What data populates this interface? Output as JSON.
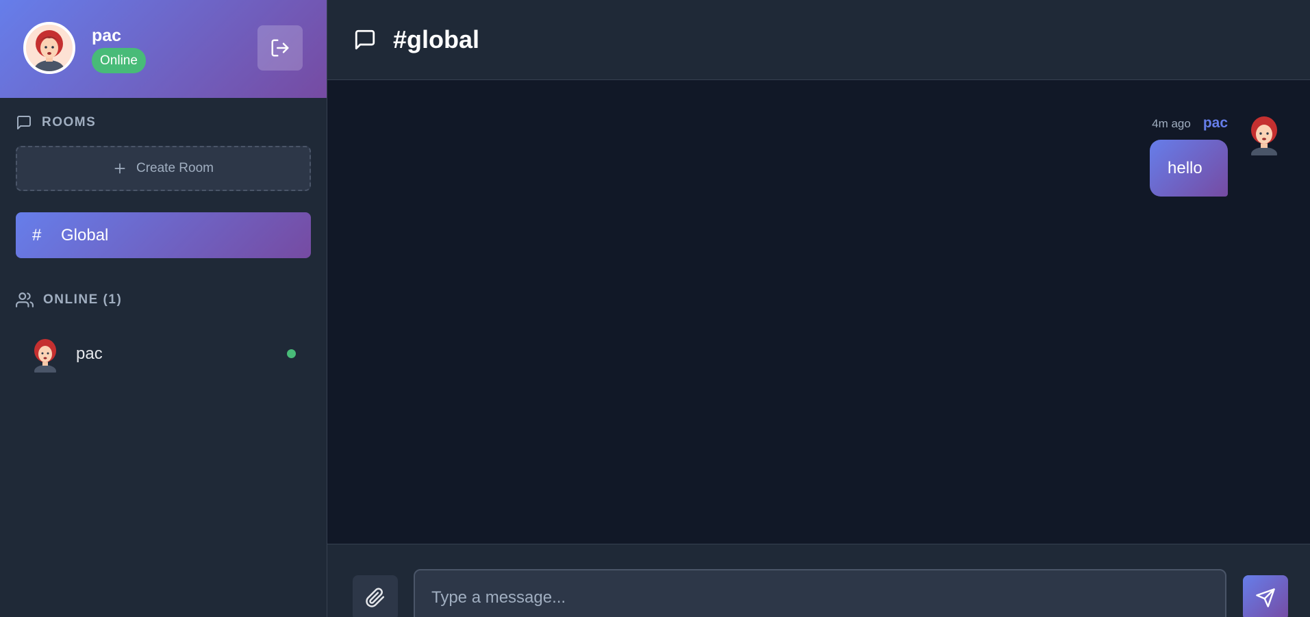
{
  "user": {
    "name": "pac",
    "status": "Online"
  },
  "sidebar": {
    "rooms_heading": "ROOMS",
    "create_room_label": "Create Room",
    "rooms": [
      {
        "hash": "#",
        "label": "Global",
        "active": true
      }
    ],
    "online_heading": "ONLINE (1)",
    "online_users": [
      {
        "name": "pac"
      }
    ]
  },
  "chat": {
    "title": "#global",
    "messages": [
      {
        "time": "4m ago",
        "author": "pac",
        "text": "hello"
      }
    ]
  },
  "composer": {
    "placeholder": "Type a message..."
  },
  "colors": {
    "accent_gradient_start": "#667eea",
    "accent_gradient_end": "#764ba2",
    "online_green": "#48bb78",
    "sidebar_bg": "#1f2937",
    "main_bg": "#111827"
  },
  "icons": {
    "logout": "logout-icon",
    "rooms": "chat-bubble-icon",
    "create": "plus-icon",
    "online": "users-icon",
    "header": "chat-bubble-icon",
    "attach": "paperclip-icon",
    "send": "send-icon"
  }
}
